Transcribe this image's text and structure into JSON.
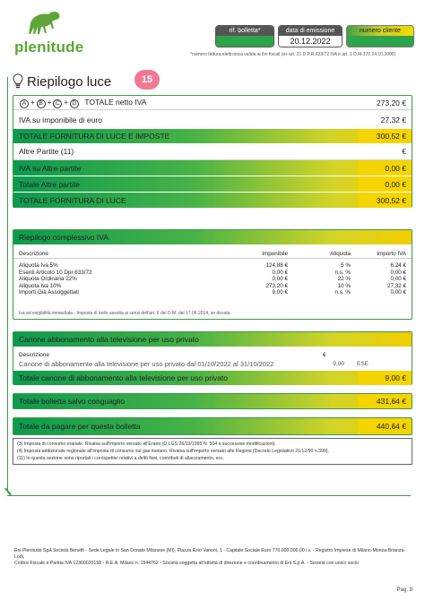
{
  "header": {
    "brand": "plenitude",
    "rif_bolletta_label": "rif. bolletta*",
    "rif_bolletta_value": "",
    "data_emissione_label": "data di emissione",
    "data_emissione_value": "20.12.2022",
    "numero_cliente_label": "numero cliente",
    "numero_cliente_value": "",
    "note": "*numero fattura elettronica valida ai fini fiscali (ex art. 21 D.P.R.633/72 IVA e art. 1 D.M.370 24.10.2000)",
    "colors": {
      "green": "#2ea44a",
      "dark": "#555555",
      "yellow": "#f5d800"
    }
  },
  "section_title": "Riepilogo luce",
  "badge": "15",
  "summary": {
    "row1_label": "TOTALE netto IVA",
    "row1_letters": [
      "A",
      "B",
      "C",
      "D"
    ],
    "row1_amount": "273,20 €",
    "row2_label": "IVA su imponibile di euro",
    "row2_amount": "27,32 €",
    "row3_label": "TOTALE FORNITURA DI LUCE E IMPOSTE",
    "row3_amount": "300,52 €",
    "row4_label": "Altre Partite (11)",
    "row4_amount": "€",
    "row5_label": "IVA su Altre partite",
    "row5_amount": "0,00 €",
    "row6_label": "Totale Altre partite",
    "row6_amount": "0,00 €",
    "row7_label": "TOTALE FORNITURA DI LUCE",
    "row7_amount": "300,52 €"
  },
  "iva": {
    "title": "Riepilogo complessivo IVA",
    "headers": [
      "Descrizione",
      "Imponibile",
      "Aliquota",
      "Importo IVA"
    ],
    "rows": [
      [
        "Aliquota Iva 5%",
        "124,88 €",
        "5 %",
        "6,24 €"
      ],
      [
        "Esenti Articolo 10 Dpr 633/72",
        "0,00 €",
        "n.s. %",
        "0,00 €"
      ],
      [
        "Aliquota Ordinaria 22%",
        "0,00 €",
        "22 %",
        "0,00 €"
      ],
      [
        "Aliquota Iva 10%",
        "273,20 €",
        "10 %",
        "27,32 €"
      ],
      [
        "Importi Già Assoggettati",
        "9,00 €",
        "n.s. %",
        "0,00 €"
      ]
    ],
    "note": "Iva ad esigibilità immediata - Imposta di bollo assolta ai sensi dell'art. 6 del D.M. del 17.06.2014, se dovuta."
  },
  "tv": {
    "title": "Canone abbonamento alla televisione per uso privato",
    "desc_header": "Descrizione",
    "currency_header": "€",
    "line_label": "Canone di abbonamento alla televisione per uso privato dal 01/10/2022 al 31/10/2022",
    "line_amount": "9,00",
    "line_code": "ESE",
    "total_label": "Totale canone di abbonamento alla televisione per uso privato",
    "total_amount": "9,00 €"
  },
  "totals": {
    "salvo_label": "Totale bolletta salvo conguaglio",
    "salvo_amount": "431,64 €",
    "pagare_label": "Totale da pagare per questa bolletta",
    "pagare_amount": "440,64 €"
  },
  "notes": [
    "(3)   Imposta di consumo erariale. Rivalsa sull'importo versato all'Erario (D.LGS 26/10/1995 N. 504 e successive modificazioni).",
    "(4)   Imposta addizionale regionale all'imposta di consumo sul gas metano. Rivalsa sull'importo versato alle Regioni (Decreto Legislativo 21/12/90 n.398).",
    "(11)  In questa sezione sono riportati i corrispettivi relativi a diritti fissi, contributi di allacciamento, ecc."
  ],
  "footer": [
    "Eni Plenitude SpA Società Benefit - Sede Legale in San Donato Milanese (MI), Piazza Ezio Vanoni, 1 - Capitale Sociale Euro 770.000.000,00 i.v. - Registro Imprese di Milano-Monza-Brianza-Lodi,",
    "Codice Fiscale e Partita IVA 12300020158 - R.E.A. Milano n. 1544762 - Società soggetta all'attività di direzione e coordinamento di Eni S.p.A. - Società con unico socio"
  ],
  "page": "Pag. 9"
}
